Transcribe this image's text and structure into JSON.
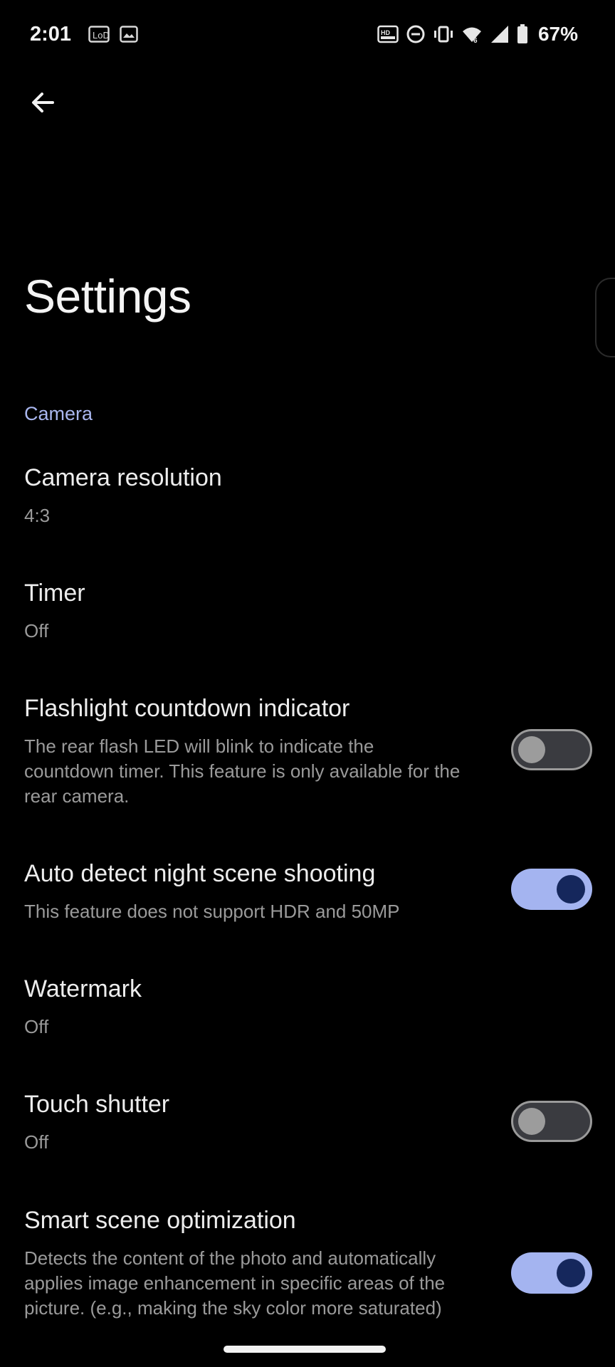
{
  "status_bar": {
    "time": "2:01",
    "battery": "67%",
    "left_icons": [
      "lockscreen-widget-icon",
      "gallery-icon"
    ],
    "right_icons": [
      "hd-voice-icon",
      "do-not-disturb-icon",
      "vibrate-icon",
      "wifi-icon",
      "signal-icon",
      "battery-icon"
    ]
  },
  "header": {
    "back_icon": "arrow-left-icon",
    "title": "Settings"
  },
  "section": {
    "label": "Camera"
  },
  "settings": [
    {
      "title": "Camera resolution",
      "subtitle": "4:3"
    },
    {
      "title": "Timer",
      "subtitle": "Off"
    },
    {
      "title": "Flashlight countdown indicator",
      "subtitle": "The rear flash LED will blink to indicate the countdown timer. This feature is only available for the rear camera.",
      "toggle": false
    },
    {
      "title": "Auto detect night scene shooting",
      "subtitle": "This feature does not support HDR and 50MP",
      "toggle": true
    },
    {
      "title": "Watermark",
      "subtitle": "Off"
    },
    {
      "title": "Touch shutter",
      "subtitle": "Off",
      "toggle": false
    },
    {
      "title": "Smart scene optimization",
      "subtitle": "Detects the content of the photo and automatically applies image enhancement in specific areas of the picture. (e.g., making the sky color more saturated)",
      "toggle": true
    }
  ],
  "colors": {
    "accent": "#a9b6ee",
    "toggle_on_track": "#a4b4f0",
    "toggle_on_knob": "#15275c",
    "background": "#000000"
  }
}
